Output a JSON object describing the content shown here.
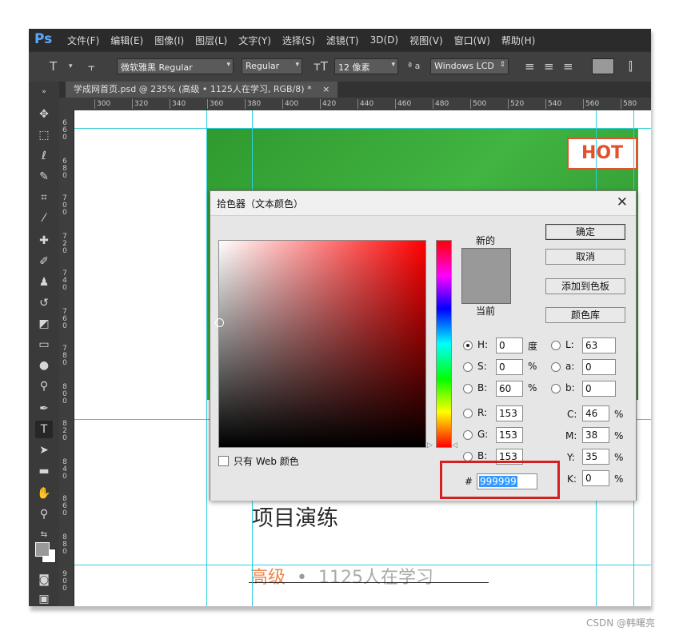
{
  "menubar": {
    "logo": "Ps",
    "items": [
      "文件(F)",
      "编辑(E)",
      "图像(I)",
      "图层(L)",
      "文字(Y)",
      "选择(S)",
      "滤镜(T)",
      "3D(D)",
      "视图(V)",
      "窗口(W)",
      "帮助(H)"
    ]
  },
  "options": {
    "font_family": "微软雅黑 Regular",
    "font_style": "Regular",
    "font_size": "12 像素",
    "aa_label": "ª a",
    "aa_mode": "Windows LCD"
  },
  "document": {
    "tab_title": "学成网首页.psd @ 235% (高级 • 1125人在学习, RGB/8) *",
    "tab_close": "×",
    "ruler_h": [
      "300",
      "320",
      "340",
      "360",
      "380",
      "400",
      "420",
      "440",
      "460",
      "480",
      "500",
      "520",
      "540",
      "560",
      "580"
    ],
    "ruler_v": [
      "6\n6\n0",
      "6\n8\n0",
      "7\n0\n0",
      "7\n2\n0",
      "7\n4\n0",
      "7\n6\n0",
      "7\n8\n0",
      "8\n0\n0",
      "8\n2\n0",
      "8\n4\n0",
      "8\n6\n0",
      "8\n8\n0",
      "9\n0\n0"
    ]
  },
  "canvas": {
    "badge": "HOT",
    "heading": "项目演练",
    "level": "高级",
    "separator": "•",
    "learners": "1125人在学习"
  },
  "picker": {
    "title": "拾色器（文本颜色）",
    "close": "✕",
    "new_label": "新的",
    "current_label": "当前",
    "new_color": "#999999",
    "buttons": {
      "ok": "确定",
      "cancel": "取消",
      "add_swatch": "添加到色板",
      "library": "颜色库"
    },
    "web_only": "只有 Web 颜色",
    "hsb": {
      "h": {
        "label": "H:",
        "value": "0",
        "unit": "度"
      },
      "s": {
        "label": "S:",
        "value": "0",
        "unit": "%"
      },
      "b": {
        "label": "B:",
        "value": "60",
        "unit": "%"
      }
    },
    "rgb": {
      "r": {
        "label": "R:",
        "value": "153"
      },
      "g": {
        "label": "G:",
        "value": "153"
      },
      "b": {
        "label": "B:",
        "value": "153"
      }
    },
    "lab": {
      "l": {
        "label": "L:",
        "value": "63"
      },
      "a": {
        "label": "a:",
        "value": "0"
      },
      "b": {
        "label": "b:",
        "value": "0"
      }
    },
    "cmyk": {
      "c": {
        "label": "C:",
        "value": "46",
        "unit": "%"
      },
      "m": {
        "label": "M:",
        "value": "38",
        "unit": "%"
      },
      "y": {
        "label": "Y:",
        "value": "35",
        "unit": "%"
      },
      "k": {
        "label": "K:",
        "value": "0",
        "unit": "%"
      }
    },
    "hex_label": "#",
    "hex_value": "999999"
  },
  "watermark": "CSDN @韩曙亮"
}
